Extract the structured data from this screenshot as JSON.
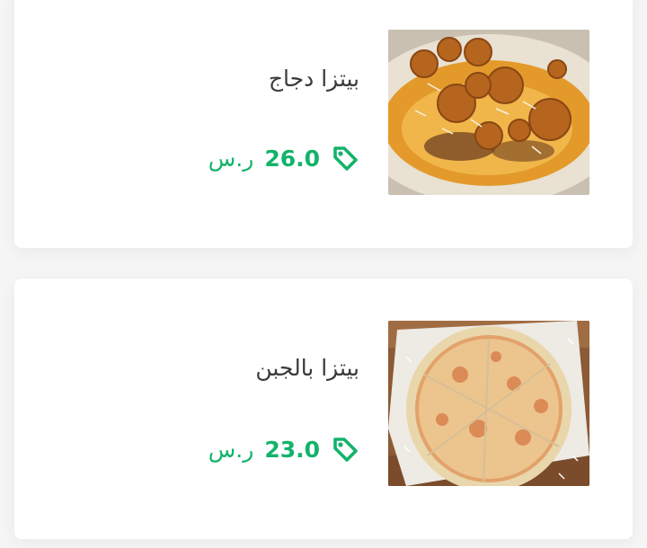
{
  "theme": {
    "accent": "#13b36a",
    "card_background": "#ffffff",
    "page_background": "#f5f5f6",
    "title_color": "#3a3a3a"
  },
  "menu_items": [
    {
      "name": "بيتزا دجاج",
      "price": "26.0",
      "currency": "ر.س",
      "price_icon": "price-tag-icon",
      "image": "chicken-pizza-photo"
    },
    {
      "name": "بيتزا بالجبن",
      "price": "23.0",
      "currency": "ر.س",
      "price_icon": "price-tag-icon",
      "image": "cheese-pizza-photo"
    }
  ]
}
